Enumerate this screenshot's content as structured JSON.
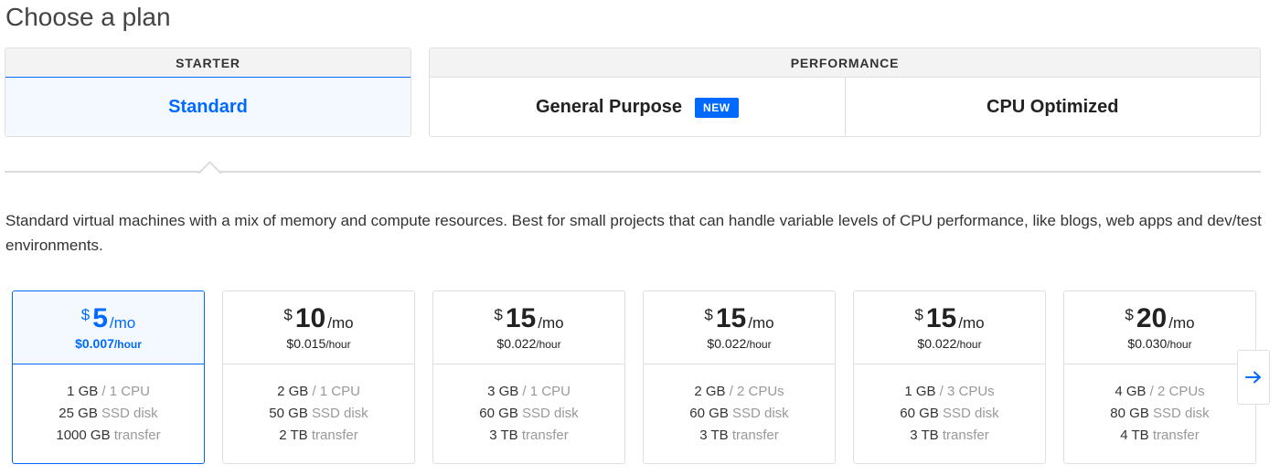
{
  "page": {
    "title": "Choose a plan"
  },
  "categories": {
    "starter": {
      "header": "STARTER",
      "tabs": [
        {
          "label": "Standard",
          "selected": true
        }
      ]
    },
    "performance": {
      "header": "PERFORMANCE",
      "tabs": [
        {
          "label": "General Purpose",
          "badge": "NEW",
          "selected": false
        },
        {
          "label": "CPU Optimized",
          "selected": false
        }
      ]
    }
  },
  "description": "Standard virtual machines with a mix of memory and compute resources. Best for small projects that can handle variable levels of CPU performance, like blogs, web apps and dev/test environments.",
  "plans": [
    {
      "currency": "$",
      "amount": "5",
      "unit": "/mo",
      "hourly": "$0.007",
      "hourly_unit": "/hour",
      "memory": "1 GB",
      "cpu": "/ 1 CPU",
      "disk": "25 GB",
      "disk_label": "SSD disk",
      "transfer": "1000 GB",
      "transfer_label": "transfer",
      "selected": true
    },
    {
      "currency": "$",
      "amount": "10",
      "unit": "/mo",
      "hourly": "$0.015",
      "hourly_unit": "/hour",
      "memory": "2 GB",
      "cpu": "/ 1 CPU",
      "disk": "50 GB",
      "disk_label": "SSD disk",
      "transfer": "2 TB",
      "transfer_label": "transfer",
      "selected": false
    },
    {
      "currency": "$",
      "amount": "15",
      "unit": "/mo",
      "hourly": "$0.022",
      "hourly_unit": "/hour",
      "memory": "3 GB",
      "cpu": "/ 1 CPU",
      "disk": "60 GB",
      "disk_label": "SSD disk",
      "transfer": "3 TB",
      "transfer_label": "transfer",
      "selected": false
    },
    {
      "currency": "$",
      "amount": "15",
      "unit": "/mo",
      "hourly": "$0.022",
      "hourly_unit": "/hour",
      "memory": "2 GB",
      "cpu": "/ 2 CPUs",
      "disk": "60 GB",
      "disk_label": "SSD disk",
      "transfer": "3 TB",
      "transfer_label": "transfer",
      "selected": false
    },
    {
      "currency": "$",
      "amount": "15",
      "unit": "/mo",
      "hourly": "$0.022",
      "hourly_unit": "/hour",
      "memory": "1 GB",
      "cpu": "/ 3 CPUs",
      "disk": "60 GB",
      "disk_label": "SSD disk",
      "transfer": "3 TB",
      "transfer_label": "transfer",
      "selected": false
    },
    {
      "currency": "$",
      "amount": "20",
      "unit": "/mo",
      "hourly": "$0.030",
      "hourly_unit": "/hour",
      "memory": "4 GB",
      "cpu": "/ 2 CPUs",
      "disk": "80 GB",
      "disk_label": "SSD disk",
      "transfer": "4 TB",
      "transfer_label": "transfer",
      "selected": false
    }
  ],
  "navigation": {
    "next_icon": "arrow-right-icon"
  },
  "colors": {
    "accent": "#0069ff",
    "selected_bg": "#f4f9ff",
    "border": "#dfdfdf",
    "muted_text": "#999999"
  }
}
